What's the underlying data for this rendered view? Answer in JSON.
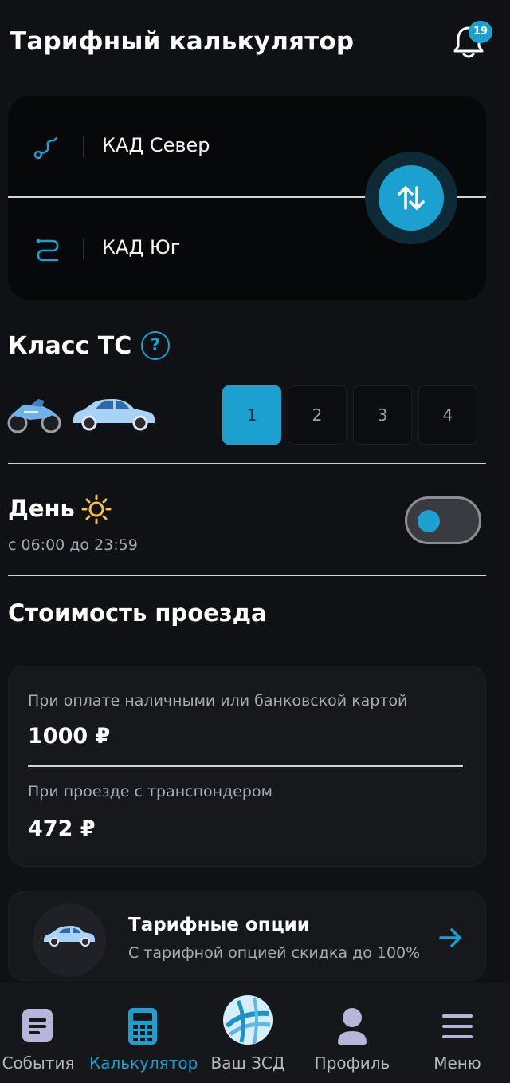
{
  "header": {
    "title": "Тарифный калькулятор",
    "notifications_count": "19"
  },
  "route": {
    "from": "КАД Север",
    "to": "КАД Юг"
  },
  "vehicle_class": {
    "title": "Класс ТС",
    "help_symbol": "?",
    "options": [
      "1",
      "2",
      "3",
      "4"
    ],
    "selected": "1"
  },
  "time_mode": {
    "title": "День",
    "hours": "с 06:00 до 23:59"
  },
  "cost": {
    "title": "Стоимость проезда",
    "cash_label": "При оплате наличными или банковской картой",
    "cash_value": "1000 ₽",
    "transponder_label": "При проезде с транспондером",
    "transponder_value": "472 ₽"
  },
  "tariff_options": {
    "title": "Тарифные опции",
    "subtitle": "С тарифной опцией скидка до 100%"
  },
  "bottom_nav": {
    "items": [
      {
        "label": "События",
        "icon": "document-icon"
      },
      {
        "label": "Калькулятор",
        "icon": "calculator-icon"
      },
      {
        "label": "Ваш ЗСД",
        "icon": "globe-logo-icon"
      },
      {
        "label": "Профиль",
        "icon": "person-icon"
      },
      {
        "label": "Меню",
        "icon": "hamburger-icon"
      }
    ],
    "active": "Калькулятор"
  },
  "colors": {
    "accent": "#1ba0cf",
    "background": "#101114",
    "card": "#17181c"
  }
}
